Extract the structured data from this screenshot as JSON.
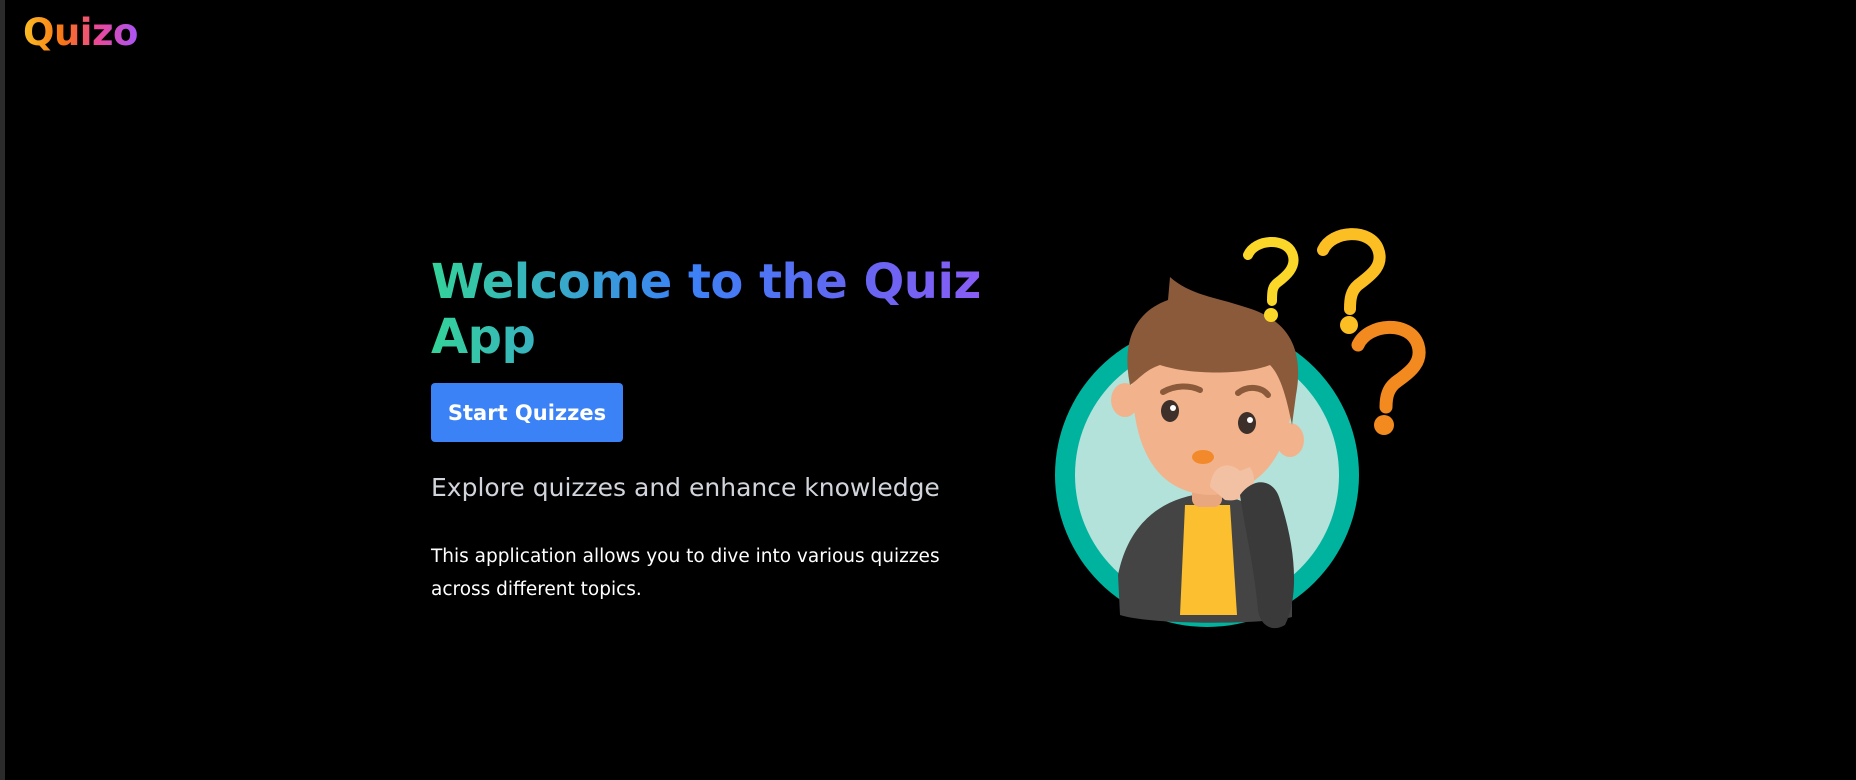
{
  "header": {
    "logo_text": "Quizo"
  },
  "hero": {
    "title": "Welcome to the Quiz App",
    "start_button_label": "Start Quizzes",
    "tagline": "Explore quizzes and enhance knowledge",
    "description": "This application allows you to dive into various quizzes across different topics."
  },
  "illustration": {
    "icon": "thinking-person-with-question-marks-icon"
  },
  "colors": {
    "background": "#000000",
    "button": "#3b82f6",
    "title_gradient": [
      "#34d399",
      "#3b82f6",
      "#6366f1",
      "#8b5cf6"
    ],
    "logo_gradient": [
      "#fbbf24",
      "#f97316",
      "#ec4899",
      "#a855f7"
    ]
  }
}
